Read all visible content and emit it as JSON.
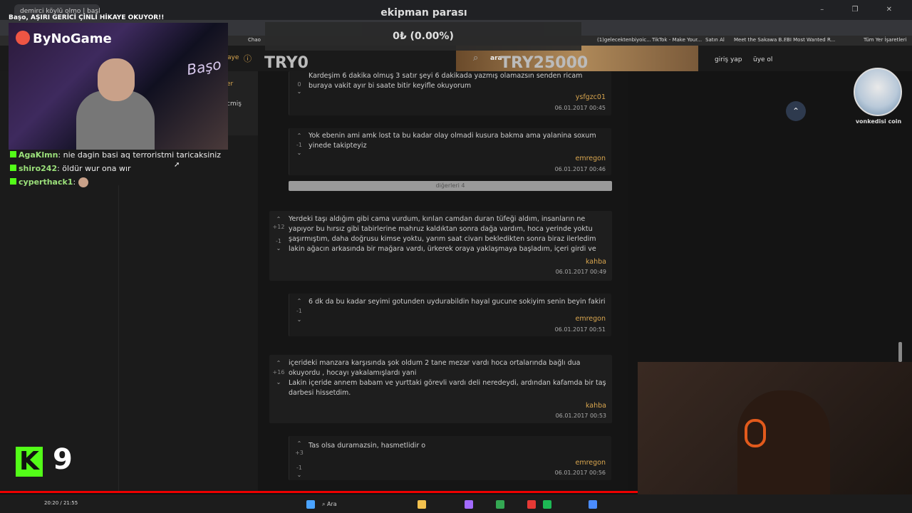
{
  "stream": {
    "title": "Başo, AŞIRI GERİCİ ÇİNLİ HİKAYE OKUYOR!!",
    "logo_text": "ByNoGame",
    "kick_count": "9",
    "time": "20:20 / 21:55"
  },
  "browser": {
    "tab_label": "demirci köylü olmo | başlık su",
    "bookmarks": [
      "Chao",
      "(1)gelecektenbiyoic...",
      "TikTok - Make Your...",
      "Satın Al",
      "Meet the Sakawa B...",
      "FBI Most Wanted R...",
      "Tüm Yer İşaretleri"
    ]
  },
  "stock": {
    "title": "ekipman parası",
    "value": "0₺ (0.00%)",
    "min": "TRY0",
    "max": "TRY25000"
  },
  "site": {
    "login": "giriş yap",
    "signup": "üye ol",
    "search_prefix": "ara",
    "side_partial_1": "aye",
    "side_partial_2": "er",
    "side_partial_3": "cmiş",
    "more_label": "diğerleri 4"
  },
  "chat": [
    {
      "user": "AgaKlmn",
      "text": "nie dagin basi aq terroristmi taricaksiniz"
    },
    {
      "user": "shiro242",
      "text": "öldür wur ona wır"
    },
    {
      "user": "cyperthack1",
      "text": ""
    }
  ],
  "entries": [
    {
      "text": "Kardeşim 6 dakika olmuş 3 satır şeyi 6 dakikada yazmış olamazsın senden ricam buraya vakit ayır bi saate bitir keyifle okuyorum",
      "author": "ysfgzc01",
      "date": "06.01.2017 00:45",
      "up": "",
      "down": "0"
    },
    {
      "text": "Yok ebenin ami amk lost ta bu kadar olay olmadi kusura bakma ama yalanina soxum yinede takipteyiz",
      "author": "emregon",
      "date": "06.01.2017 00:46",
      "up": "",
      "down": "-1"
    },
    {
      "text": "Yerdeki taşı aldığım gibi cama vurdum, kırılan camdan duran tüfeği aldım, insanların ne yapıyor bu hırsız gibi tabirlerine mahruz kaldıktan sonra dağa vardım, hoca yerinde yoktu şaşırmıştım, daha doğrusu kimse yoktu, yarım saat civarı bekledikten sonra biraz ilerledim lakin ağacın arkasında bir mağara vardı, ürkerek oraya yaklaşmaya başladım, içeri girdi ve",
      "author": "kahba",
      "date": "06.01.2017 00:49",
      "up": "+12",
      "down": "-1"
    },
    {
      "text": "6 dk da bu kadar seyimi gotunden uydurabildin hayal gucune sokiyim senin beyin fakiri",
      "author": "emregon",
      "date": "06.01.2017 00:51",
      "up": "",
      "down": "-1"
    },
    {
      "text1": "içerideki manzara karşısında şok oldum 2 tane mezar vardı hoca ortalarında bağlı dua okuyordu , hocayı yakalamışlardı yani",
      "text2": "Lakin içeride annem babam ve yurttaki görevli vardı deli neredeydi, ardından kafamda bir taş darbesi hissetdim.",
      "author": "kahba",
      "date": "06.01.2017 00:53",
      "up": "+16",
      "down": ""
    },
    {
      "text": "Tas olsa duramazsin, hasmetlidir o",
      "author": "emregon",
      "date": "06.01.2017 00:56",
      "up": "+3",
      "down": "-1"
    }
  ],
  "avatar_caption": "vonkedisi coin",
  "colors": {
    "author": "#d9a64f",
    "kick": "#53fc18",
    "progress": "#ee0000"
  }
}
